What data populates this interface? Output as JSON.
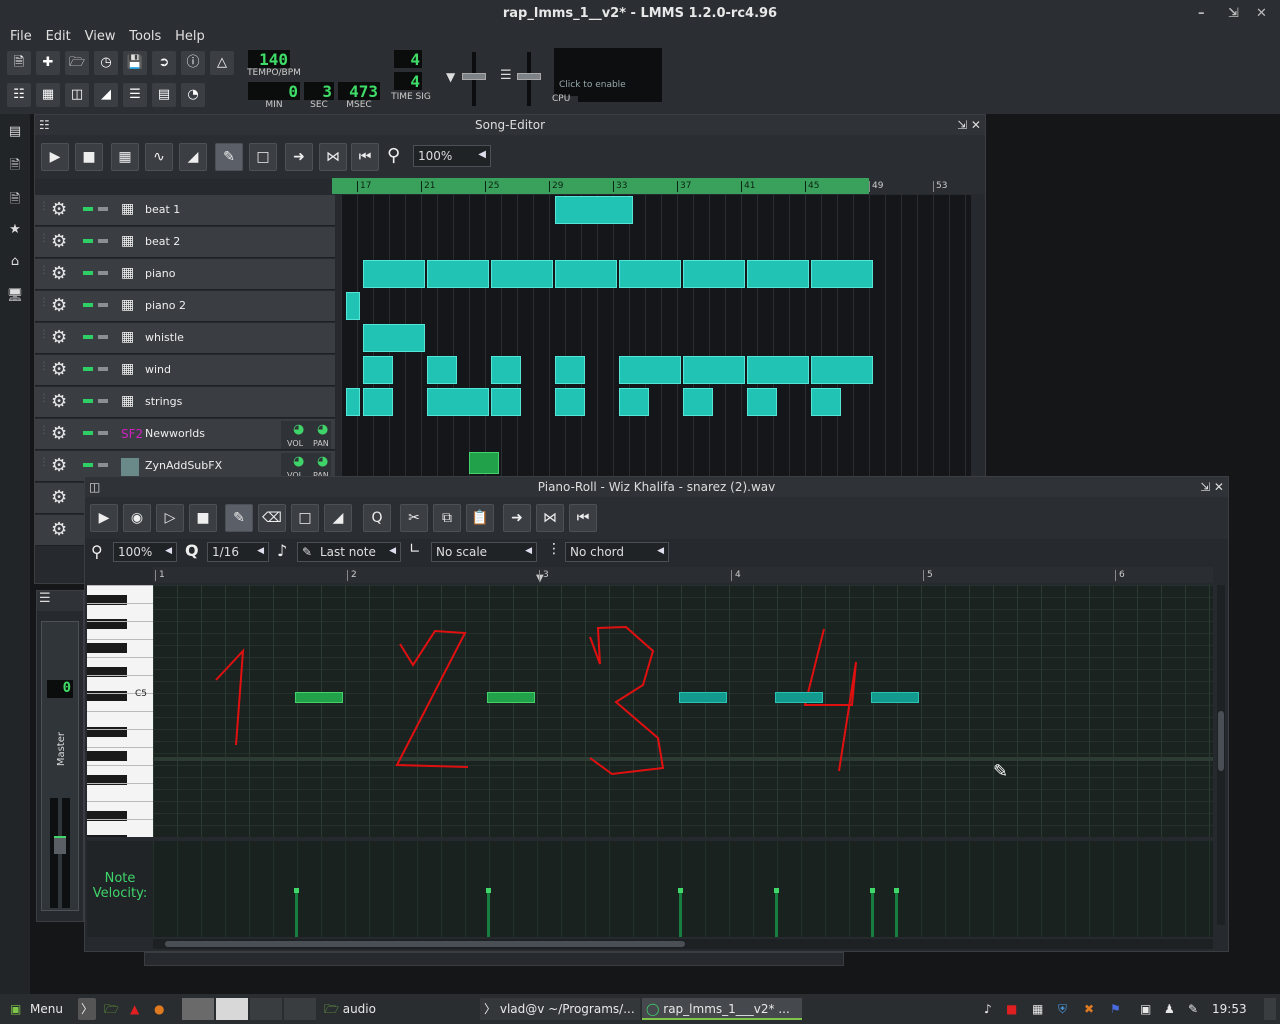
{
  "window": {
    "title": "rap_lmms_1__v2* - LMMS 1.2.0-rc4.96"
  },
  "menu": [
    {
      "label": "File"
    },
    {
      "label": "Edit"
    },
    {
      "label": "View"
    },
    {
      "label": "Tools"
    },
    {
      "label": "Help"
    }
  ],
  "transport": {
    "tempo": "140",
    "tempo_label": "TEMPO/BPM",
    "min": "0",
    "min_label": "MIN",
    "sec": "3",
    "sec_label": "SEC",
    "msec": "473",
    "msec_label": "MSEC",
    "timesig_num": "4",
    "timesig_den": "4",
    "timesig_label": "TIME SIG",
    "cpu_hint": "Click to enable",
    "cpu_label": "CPU"
  },
  "song_editor": {
    "title": "Song-Editor",
    "zoom": "100%",
    "ruler": [
      "17",
      "21",
      "25",
      "29",
      "33",
      "37",
      "41",
      "45",
      "49",
      "53"
    ],
    "tracks": [
      {
        "name": "beat 1",
        "icon": "beat-pattern-icon"
      },
      {
        "name": "beat 2",
        "icon": "beat-pattern-icon"
      },
      {
        "name": "piano",
        "icon": "beat-pattern-icon"
      },
      {
        "name": "piano 2",
        "icon": "beat-pattern-icon"
      },
      {
        "name": "whistle",
        "icon": "beat-pattern-icon"
      },
      {
        "name": "wind",
        "icon": "beat-pattern-icon"
      },
      {
        "name": "strings",
        "icon": "beat-pattern-icon"
      },
      {
        "name": "Newworlds",
        "icon": "sf2-player-icon"
      },
      {
        "name": "ZynAddSubFX",
        "icon": "zynaddsubfx-icon"
      }
    ],
    "knob_vol": "VOL",
    "knob_pan": "PAN"
  },
  "piano_roll": {
    "title": "Piano-Roll - Wiz Khalifa - snarez (2).wav",
    "zoom": "100%",
    "quantize": "1/16",
    "note_length": "Last note",
    "scale": "No scale",
    "chord": "No chord",
    "ruler": [
      "1",
      "2",
      "3",
      "4",
      "5",
      "6"
    ],
    "key_label": "C5",
    "velocity_label_1": "Note",
    "velocity_label_2": "Velocity:",
    "annotations": [
      "1",
      "2",
      "3",
      "4"
    ]
  },
  "mixer": {
    "master_label": "Master",
    "lcd": "0"
  },
  "taskbar": {
    "menu_label": "Menu",
    "items": [
      {
        "label": "audio"
      },
      {
        "label": "vlad@v ~/Programs/..."
      },
      {
        "label": "rap_lmms_1___v2* ..."
      }
    ],
    "clock": "19:53"
  }
}
